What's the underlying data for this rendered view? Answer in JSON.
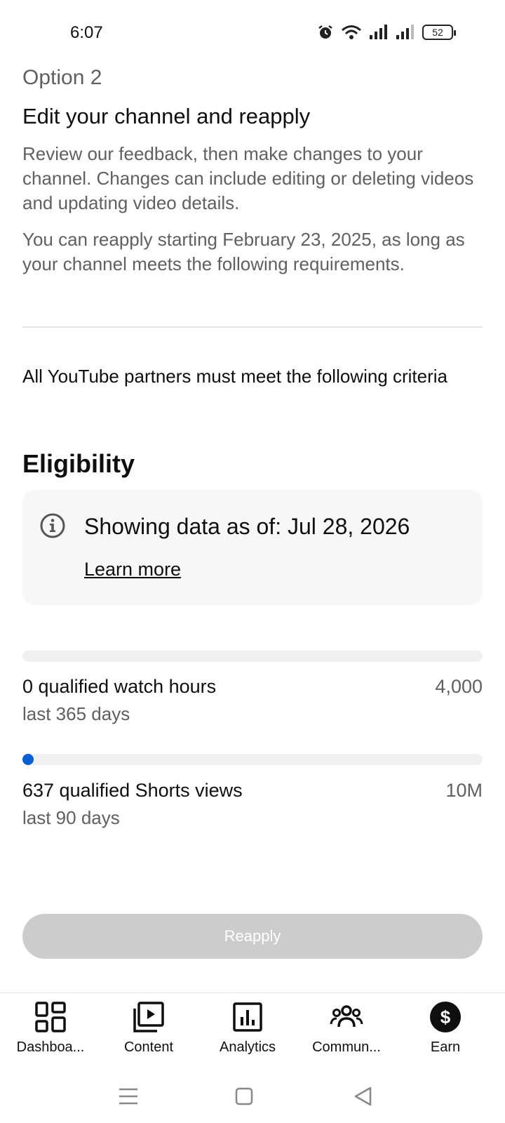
{
  "status_bar": {
    "time": "6:07",
    "battery": "52",
    "icons": [
      "alarm-icon",
      "wifi-icon",
      "signal-icon",
      "signal-icon",
      "battery-icon"
    ]
  },
  "option": {
    "label": "Option 2",
    "title": "Edit your channel and reapply",
    "paragraph1": "Review our feedback, then make changes to your channel. Changes can include editing or deleting videos and updating video details.",
    "paragraph2": "You can reapply starting February 23, 2025, as long as your channel meets the following requirements."
  },
  "criteria_text": "All YouTube partners must meet the following criteria",
  "eligibility": {
    "heading": "Eligibility",
    "info_text": "Showing data as of: Jul 28, 2026",
    "learn_more": "Learn more"
  },
  "metrics": [
    {
      "label": "0 qualified watch hours",
      "sublabel": "last 365 days",
      "target": "4,000",
      "progress": 0
    },
    {
      "label": "637 qualified Shorts views",
      "sublabel": "last 90 days",
      "target": "10M",
      "progress": 6.37e-05
    }
  ],
  "reapply_button": "Reapply",
  "colors": {
    "accent": "#065fd4",
    "disabled_button": "#cccccc",
    "secondary_text": "#606060"
  },
  "bottom_nav": [
    {
      "label": "Dashboa...",
      "icon": "dashboard-icon"
    },
    {
      "label": "Content",
      "icon": "content-icon"
    },
    {
      "label": "Analytics",
      "icon": "analytics-icon"
    },
    {
      "label": "Commun...",
      "icon": "community-icon"
    },
    {
      "label": "Earn",
      "icon": "earn-icon"
    }
  ],
  "system_nav": [
    "menu-icon",
    "home-icon",
    "back-icon"
  ]
}
